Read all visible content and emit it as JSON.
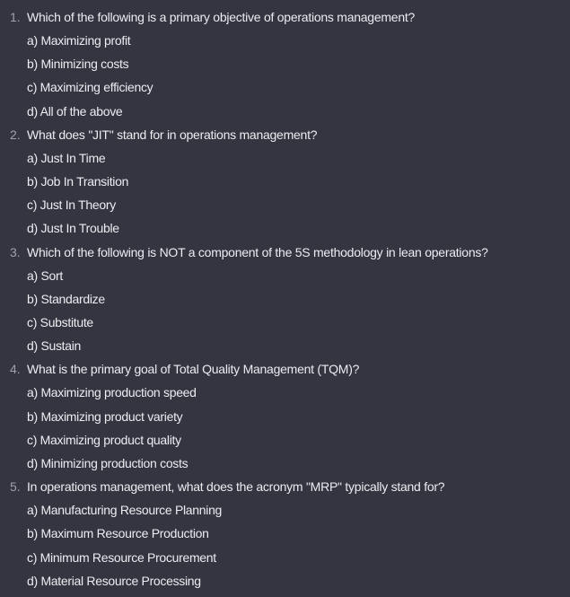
{
  "questions": [
    {
      "number": "1.",
      "text": "Which of the following is a primary objective of operations management?",
      "options": [
        "a) Maximizing profit",
        "b) Minimizing costs",
        "c) Maximizing efficiency",
        "d) All of the above"
      ]
    },
    {
      "number": "2.",
      "text": "What does \"JIT\" stand for in operations management?",
      "options": [
        "a) Just In Time",
        "b) Job In Transition",
        "c) Just In Theory",
        "d) Just In Trouble"
      ]
    },
    {
      "number": "3.",
      "text": "Which of the following is NOT a component of the 5S methodology in lean operations?",
      "options": [
        "a) Sort",
        "b) Standardize",
        "c) Substitute",
        "d) Sustain"
      ]
    },
    {
      "number": "4.",
      "text": "What is the primary goal of Total Quality Management (TQM)?",
      "options": [
        "a) Maximizing production speed",
        "b) Maximizing product variety",
        "c) Maximizing product quality",
        "d) Minimizing production costs"
      ]
    },
    {
      "number": "5.",
      "text": "In operations management, what does the acronym \"MRP\" typically stand for?",
      "options": [
        "a) Manufacturing Resource Planning",
        "b) Maximum Resource Production",
        "c) Minimum Resource Procurement",
        "d) Material Resource Processing"
      ]
    }
  ]
}
